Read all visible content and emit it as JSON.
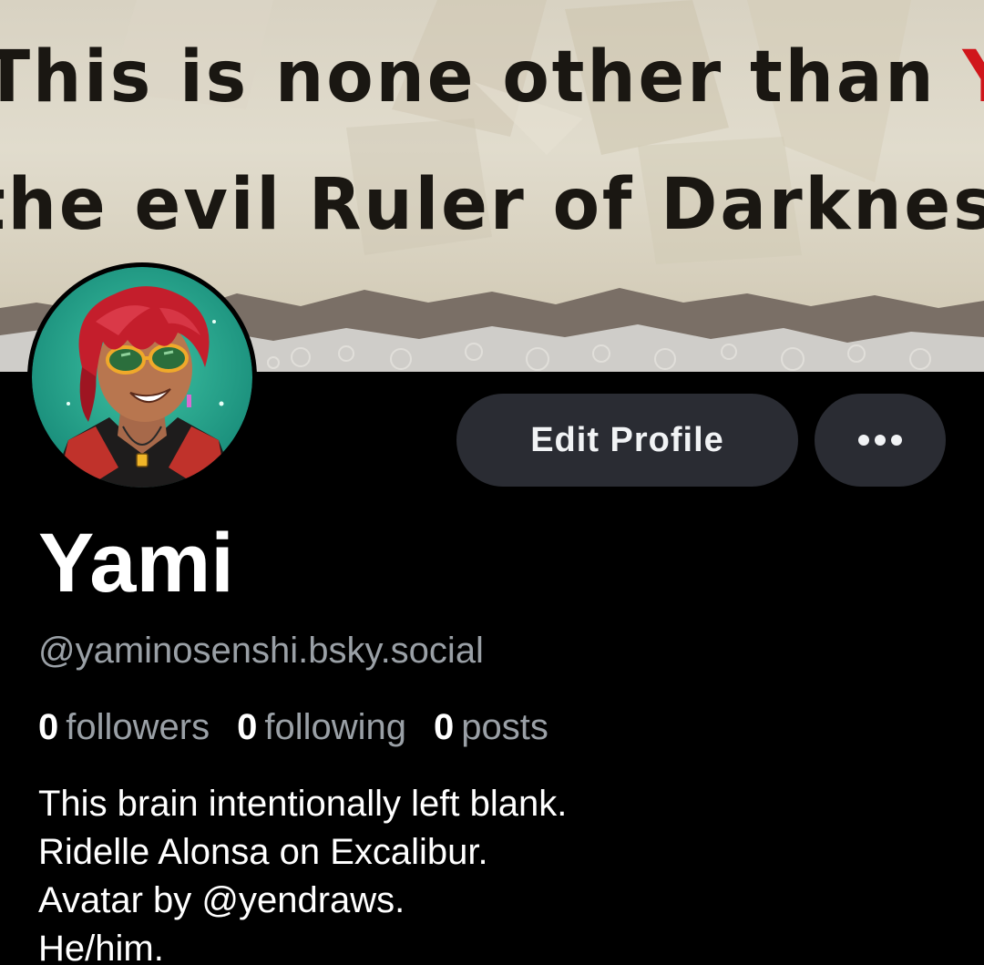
{
  "banner": {
    "line1": {
      "before": "This is none other than ",
      "highlight": "Yami"
    },
    "line2": "the evil Ruler of Darkness.",
    "highlight_color": "#d0161b"
  },
  "avatar": {
    "icon": "avatar-image"
  },
  "actions": {
    "edit_profile_label": "Edit Profile",
    "more_icon": "more-horizontal-icon"
  },
  "profile": {
    "display_name": "Yami",
    "handle": "@yaminosenshi.bsky.social",
    "stats": [
      {
        "count": "0",
        "label": "followers"
      },
      {
        "count": "0",
        "label": "following"
      },
      {
        "count": "0",
        "label": "posts"
      }
    ],
    "bio_lines": [
      "This brain intentionally left blank.",
      "Ridelle Alonsa on Excalibur.",
      "Avatar by @yendraws.",
      "He/him."
    ]
  },
  "colors": {
    "background": "#000000",
    "button_bg": "#2a2c33",
    "muted_text": "#9aa0a6",
    "text": "#ffffff"
  }
}
